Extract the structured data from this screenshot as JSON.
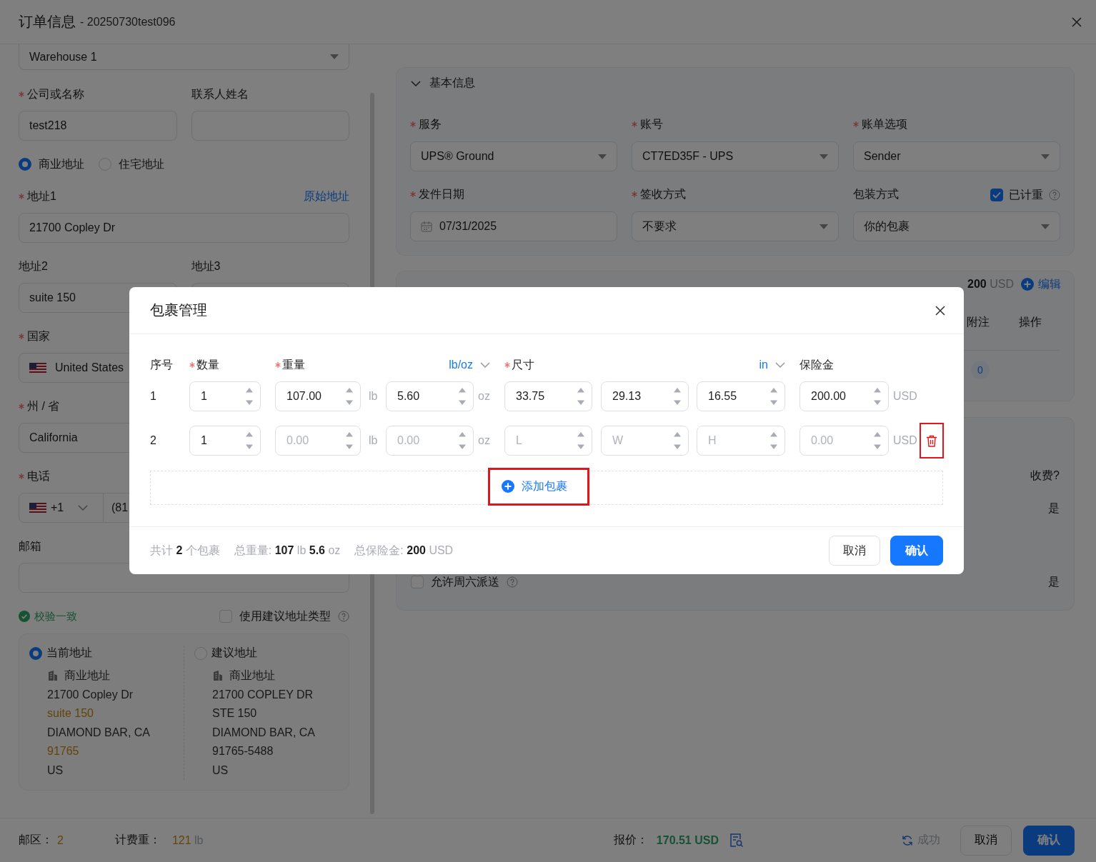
{
  "window": {
    "title": "订单信息",
    "subtitle": "- 20250730test096"
  },
  "sender": {
    "warehouse": "Warehouse 1",
    "company": {
      "label": "公司或名称",
      "required": true,
      "value": "test218"
    },
    "contact": {
      "label": "联系人姓名",
      "required": false
    },
    "address_types": [
      {
        "label": "商业地址",
        "selected": true
      },
      {
        "label": "住宅地址",
        "selected": false
      }
    ],
    "address1": {
      "label": "地址1",
      "required": true,
      "link": "原始地址",
      "value": "21700 Copley Dr"
    },
    "address2": {
      "label": "地址2",
      "required": false,
      "value": "suite 150"
    },
    "address3": {
      "label": "地址3",
      "required": false
    },
    "country": {
      "label": "国家",
      "required": true,
      "value": "United States"
    },
    "state": {
      "label": "州 / 省",
      "required": true,
      "value": "California"
    },
    "phone": {
      "label": "电话",
      "required": true,
      "code": "+1",
      "value": "(81"
    },
    "email": {
      "label": "邮箱",
      "required": false
    },
    "validation": "校验一致",
    "use_suggested_type": {
      "label": "使用建议地址类型",
      "checked": false
    },
    "address_choices": [
      {
        "title": "当前地址",
        "selected": true,
        "type": "商业地址",
        "lines": [
          {
            "text": "21700 Copley Dr",
            "changed": false
          },
          {
            "text": "suite 150",
            "changed": true
          },
          {
            "text": "DIAMOND BAR, CA",
            "changed": false
          },
          {
            "text": "91765",
            "changed": true
          },
          {
            "text": "US",
            "changed": false
          }
        ]
      },
      {
        "title": "建议地址",
        "selected": false,
        "type": "商业地址",
        "lines": [
          {
            "text": "21700 COPLEY DR",
            "changed": false
          },
          {
            "text": "STE 150",
            "changed": false
          },
          {
            "text": "DIAMOND BAR, CA",
            "changed": false
          },
          {
            "text": "91765-5488",
            "changed": false
          },
          {
            "text": "US",
            "changed": false
          }
        ]
      }
    ]
  },
  "basic_section": {
    "title": "基本信息",
    "expanded": true,
    "fields": [
      {
        "label": "服务",
        "required": true,
        "kind": "select",
        "value": "UPS® Ground"
      },
      {
        "label": "账号",
        "required": true,
        "kind": "select",
        "value": "CT7ED35F - UPS"
      },
      {
        "label": "账单选项",
        "required": true,
        "kind": "select",
        "value": "Sender"
      },
      {
        "label": "发件日期",
        "required": true,
        "kind": "date",
        "value": "07/31/2025"
      },
      {
        "label": "签收方式",
        "required": true,
        "kind": "select",
        "value": "不要求"
      },
      {
        "label": "包装方式",
        "required": false,
        "kind": "select",
        "value": "你的包裹",
        "checkbox": {
          "label": "已计重",
          "checked": true
        }
      }
    ]
  },
  "package_section": {
    "insurance_total": "**200** USD",
    "edit": "编辑",
    "columns": [
      "附注",
      "操作"
    ],
    "badge": "0"
  },
  "options_section": {
    "column": "收费?",
    "rows": [
      {
        "kind": "plain",
        "value": "是"
      },
      {
        "kind": "checkbox",
        "label": "允许周六派送",
        "checked": false,
        "value": "是"
      }
    ]
  },
  "footer": {
    "zone": {
      "label": "邮区：",
      "value": "2"
    },
    "billed_weight": {
      "label": "计费重：",
      "value": "121",
      "unit": "lb"
    },
    "quote": {
      "label": "报价：",
      "value": "170.51 USD"
    },
    "status": "成功",
    "buttons": [
      {
        "label": "取消",
        "kind": "default"
      },
      {
        "label": "确认",
        "kind": "primary"
      }
    ]
  },
  "package_dialog": {
    "title": "包裹管理",
    "columns": [
      {
        "label": "序号",
        "required": false
      },
      {
        "label": "数量",
        "required": true
      },
      {
        "label": "重量",
        "required": true,
        "unit": "lb/oz"
      },
      {
        "label": "尺寸",
        "required": true,
        "unit": "in"
      },
      {
        "label": "保险金",
        "required": false
      }
    ],
    "rows": [
      {
        "index": "1",
        "quantity": {
          "value": "1"
        },
        "pounds": {
          "value": "107.00"
        },
        "pound_unit": "lb",
        "ounces": {
          "value": "5.60"
        },
        "ounce_unit": "oz",
        "length": {
          "value": "33.75"
        },
        "width": {
          "value": "29.13"
        },
        "height": {
          "value": "16.55"
        },
        "insurance": {
          "value": "200.00"
        },
        "currency": "USD",
        "removable": false
      },
      {
        "index": "2",
        "quantity": {
          "value": "1"
        },
        "pounds": {
          "placeholder": "0.00"
        },
        "pound_unit": "lb",
        "ounces": {
          "placeholder": "0.00"
        },
        "ounce_unit": "oz",
        "length": {
          "placeholder": "L"
        },
        "width": {
          "placeholder": "W"
        },
        "height": {
          "placeholder": "H"
        },
        "insurance": {
          "placeholder": "0.00"
        },
        "currency": "USD",
        "removable": true,
        "highlighted": true
      }
    ],
    "add": {
      "label": "添加包裹",
      "highlighted": true
    },
    "summary": [
      "共计 **2** 个包裹",
      "总重量: **107** lb **5.6** oz",
      "总保险金: **200** USD"
    ],
    "buttons": [
      {
        "label": "取消",
        "kind": "default"
      },
      {
        "label": "确认",
        "kind": "primary"
      }
    ]
  }
}
